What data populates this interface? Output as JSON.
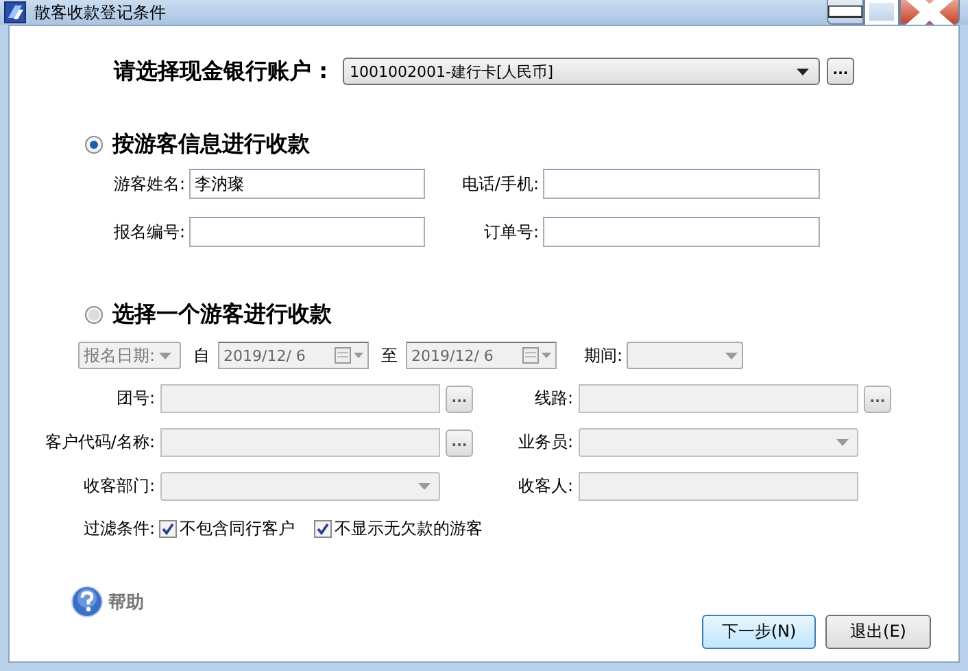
{
  "window": {
    "title": "散客收款登记条件"
  },
  "account": {
    "label": "请选择现金银行账户 :",
    "value": "1001002001-建行卡[人民币]",
    "button": "..."
  },
  "modes": [
    {
      "label": "按游客信息进行收款",
      "selected": true,
      "rows": [
        [
          {
            "label": "游客姓名:",
            "kind": "text",
            "value": "李汭璨",
            "disabled": false
          },
          {
            "label": "电话/手机:",
            "kind": "text",
            "disabled": false
          }
        ],
        [
          {
            "label": "报名编号:",
            "kind": "text",
            "disabled": false
          },
          {
            "label": "订单号:",
            "kind": "text",
            "disabled": false
          }
        ]
      ]
    },
    {
      "label": "选择一个游客进行收款",
      "selected": false,
      "date_filter": {
        "type_value": "报名日期:",
        "from_label": "自",
        "from": "2019/12/ 6",
        "to_label": "至",
        "to": "2019/12/ 6",
        "period_label": "期间:",
        "disabled": true
      },
      "rows": [
        [
          {
            "label": "团号:",
            "kind": "lookup",
            "button": "...",
            "disabled": true
          },
          {
            "label": "线路:",
            "kind": "lookup",
            "button": "...",
            "disabled": true
          }
        ],
        [
          {
            "label": "客户代码/名称:",
            "kind": "lookup",
            "button": "...",
            "disabled": true
          },
          {
            "label": "业务员:",
            "kind": "combo",
            "disabled": true
          }
        ],
        [
          {
            "label": "收客部门:",
            "kind": "combo",
            "disabled": true
          },
          {
            "label": "收客人:",
            "kind": "text",
            "disabled": true
          }
        ]
      ],
      "filter": {
        "label": "过滤条件:",
        "options": [
          {
            "label": "不包含同行客户",
            "checked": true
          },
          {
            "label": "不显示无欠款的游客",
            "checked": true
          }
        ]
      }
    }
  ],
  "help": {
    "label": "帮助"
  },
  "buttons": [
    {
      "label": "下一步(N)",
      "default": true
    },
    {
      "label": "退出(E)",
      "default": false
    }
  ]
}
